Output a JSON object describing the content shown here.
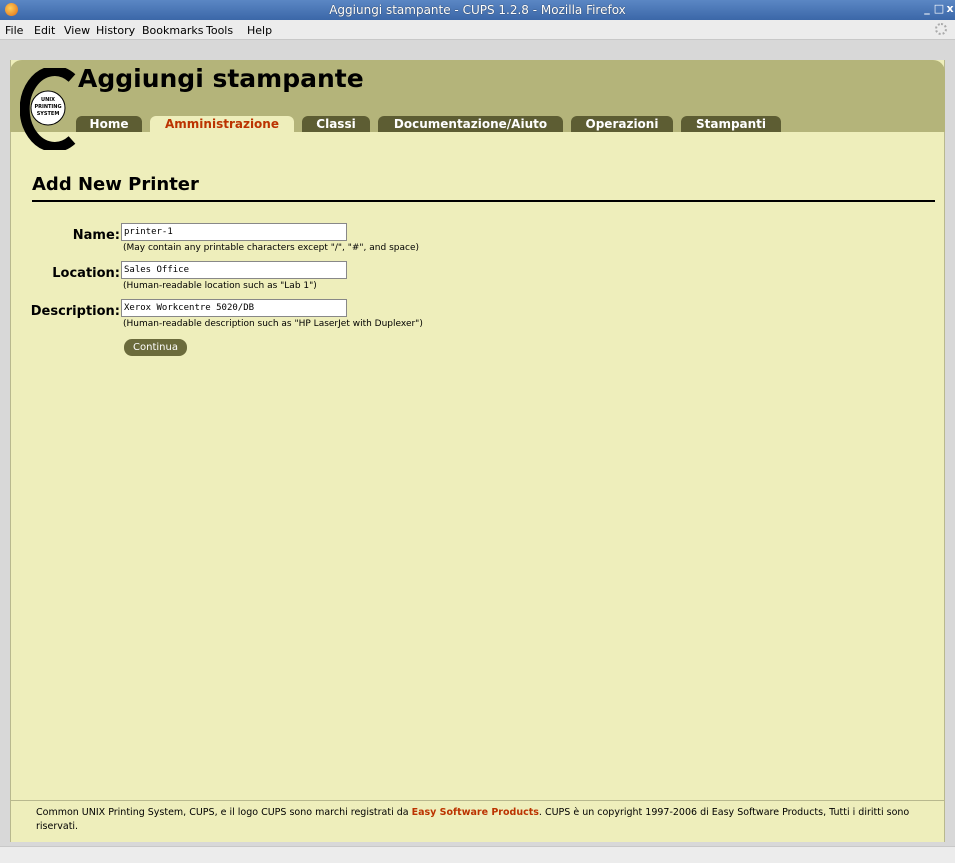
{
  "window": {
    "title": "Aggiungi stampante - CUPS 1.2.8 - Mozilla Firefox",
    "minimize_glyph": "_",
    "maximize_glyph": "□",
    "close_glyph": "x"
  },
  "menubar": {
    "items": [
      "File",
      "Edit",
      "View",
      "History",
      "Bookmarks",
      "Tools",
      "Help"
    ]
  },
  "header": {
    "page_title": "Aggiungi stampante",
    "logo_text": [
      "UNIX",
      "PRINTING",
      "SYSTEM"
    ],
    "tabs": [
      {
        "label": "Home",
        "active": false
      },
      {
        "label": "Amministrazione",
        "active": true
      },
      {
        "label": "Classi",
        "active": false
      },
      {
        "label": "Documentazione/Aiuto",
        "active": false
      },
      {
        "label": "Operazioni",
        "active": false
      },
      {
        "label": "Stampanti",
        "active": false
      }
    ]
  },
  "form": {
    "section_title": "Add New Printer",
    "fields": [
      {
        "label": "Name:",
        "value": "printer-1",
        "help": "(May contain any printable characters except \"/\", \"#\", and space)"
      },
      {
        "label": "Location:",
        "value": "Sales Office",
        "help": "(Human-readable location such as \"Lab 1\")"
      },
      {
        "label": "Description:",
        "value": "Xerox Workcentre 5020/DB",
        "help": "(Human-readable description such as \"HP LaserJet with Duplexer\")"
      }
    ],
    "continue_label": "Continua"
  },
  "footer": {
    "text_before": "Common UNIX Printing System, CUPS, e il logo CUPS sono marchi registrati da ",
    "link": "Easy Software Products",
    "text_after": ". CUPS è un copyright 1997-2006 di Easy Software Products, Tutti i diritti sono riservati."
  },
  "colors": {
    "page_bg": "#eeeebb",
    "header_band": "#b4b47a",
    "tab_bg": "#5d5d33",
    "tab_active_text": "#bb3300",
    "link": "#bb3300",
    "button_bg": "#6b6b3c"
  }
}
